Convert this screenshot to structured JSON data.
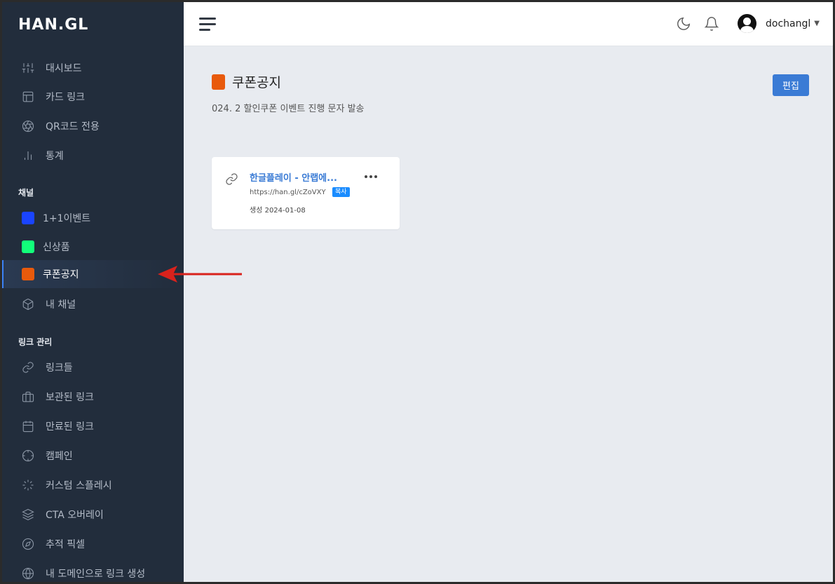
{
  "brand": {
    "logo": "HAN.GL"
  },
  "sidebar": {
    "main_items": [
      {
        "label": "대시보드",
        "icon": "sliders-icon"
      },
      {
        "label": "카드 링크",
        "icon": "layout-icon"
      },
      {
        "label": "QR코드 전용",
        "icon": "aperture-icon"
      },
      {
        "label": "통계",
        "icon": "bar-chart-icon"
      }
    ],
    "channel_section": "채널",
    "channels": [
      {
        "label": "1+1이벤트",
        "color": "#1a44ff"
      },
      {
        "label": "신상품",
        "color": "#12ff7a"
      },
      {
        "label": "쿠폰공지",
        "color": "#e85a0c",
        "active": true
      }
    ],
    "my_channel": "내 채널",
    "link_section": "링크 관리",
    "link_items": [
      {
        "label": "링크들",
        "icon": "link-icon"
      },
      {
        "label": "보관된 링크",
        "icon": "briefcase-icon"
      },
      {
        "label": "만료된 링크",
        "icon": "calendar-icon"
      },
      {
        "label": "캠페인",
        "icon": "crosshair-icon"
      },
      {
        "label": "커스텀 스플레시",
        "icon": "loader-icon"
      },
      {
        "label": "CTA 오버레이",
        "icon": "layers-icon"
      },
      {
        "label": "추적 픽셀",
        "icon": "compass-icon"
      },
      {
        "label": "내 도메인으로 링크 생성",
        "icon": "globe-icon"
      }
    ]
  },
  "header": {
    "username": "dochangl"
  },
  "page": {
    "title": "쿠폰공지",
    "title_color": "#e85a0c",
    "subtitle": "024. 2 할인쿠폰 이벤트 진행 문자 발송",
    "edit_label": "편집"
  },
  "card": {
    "title": "한글플레이 - 안랩에...",
    "url": "https://han.gl/cZoVXY",
    "copy_label": "복사",
    "created": "생성 2024-01-08"
  }
}
